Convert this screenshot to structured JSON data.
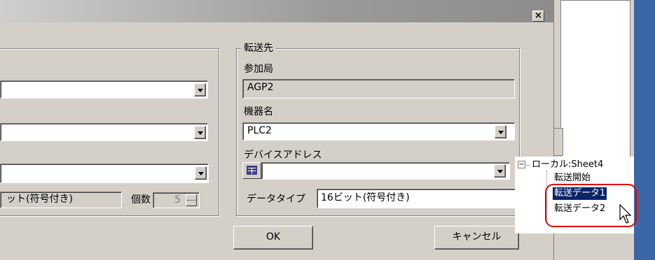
{
  "window": {
    "close_glyph": "×"
  },
  "left": {
    "type_value": "ット(符号付き)",
    "count_label": "個数",
    "count_value": "5"
  },
  "dest": {
    "group_title": "転送先",
    "station_label": "参加局",
    "station_value": "AGP2",
    "device_label": "機器名",
    "device_value": "PLC2",
    "address_label": "デバイスアドレス",
    "datatype_label": "データタイプ",
    "datatype_value": "16ビット(符号付き)"
  },
  "buttons": {
    "ok": "OK",
    "cancel": "キャンセル"
  },
  "tree": {
    "root": "ローカル:Sheet4",
    "items": [
      "転送開始",
      "転送データ1",
      "転送データ2"
    ],
    "expander": "⊟"
  }
}
